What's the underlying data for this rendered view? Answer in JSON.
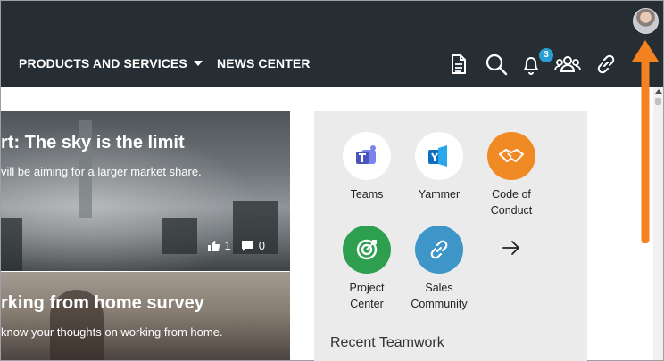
{
  "topbar": {
    "nav": [
      {
        "label": "PRODUCTS AND SERVICES"
      },
      {
        "label": "NEWS CENTER"
      }
    ],
    "notification_count": "3",
    "icons": [
      "document-icon",
      "search-icon",
      "bell-icon",
      "people-icon",
      "link-icon",
      "avatar"
    ]
  },
  "news": [
    {
      "title": "rt: The sky is the limit",
      "description": "vill be aiming for a larger market share.",
      "likes": "1",
      "comments": "0"
    },
    {
      "title": "rking from home survey",
      "description": "know your thoughts on working from home."
    }
  ],
  "apps": {
    "items": [
      {
        "label": "Teams",
        "icon": "teams-icon",
        "color": "#ffffff"
      },
      {
        "label": "Yammer",
        "icon": "yammer-icon",
        "color": "#ffffff"
      },
      {
        "label": "Code of Conduct",
        "icon": "handshake-icon",
        "color": "#f08a24"
      },
      {
        "label": "Project Center",
        "icon": "target-icon",
        "color": "#2e9e4f"
      },
      {
        "label": "Sales Community",
        "icon": "link-icon",
        "color": "#3d95c8"
      }
    ],
    "more_icon": "arrow-right-icon",
    "recent_title": "Recent Teamwork"
  },
  "colors": {
    "topbar": "#272e33",
    "badge": "#2a9fd6",
    "annotation_arrow": "#f58220",
    "panel_bg": "#ebebeb"
  }
}
